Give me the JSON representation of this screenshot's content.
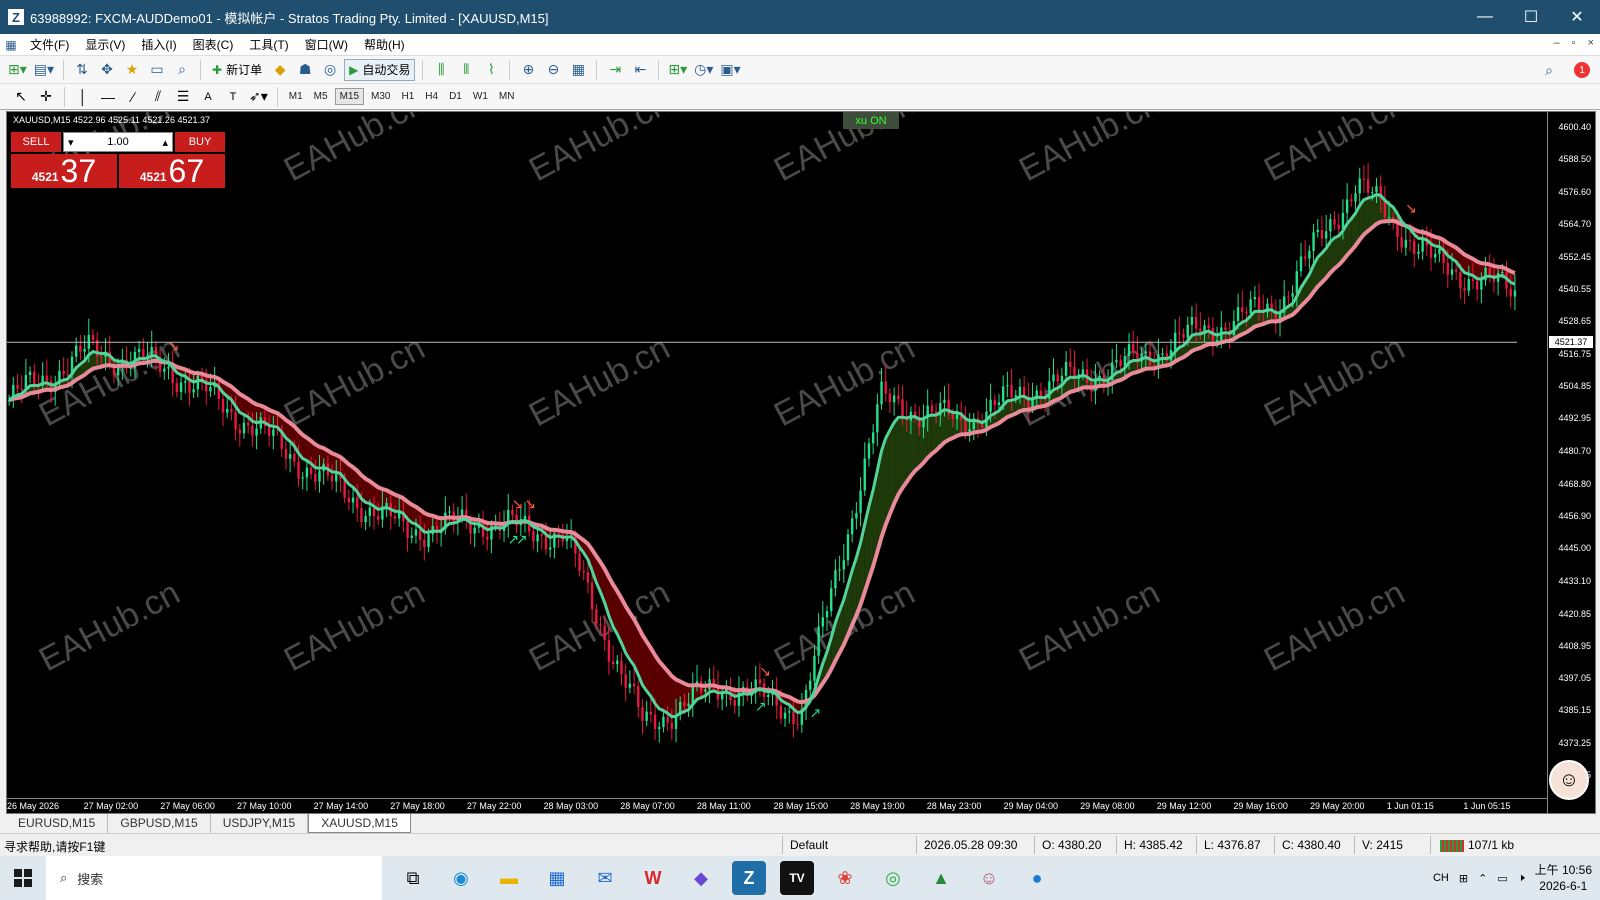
{
  "window": {
    "title": "63988992: FXCM-AUDDemo01 - 模拟帐户 - Stratos Trading Pty. Limited - [XAUUSD,M15]",
    "app_icon": "Z",
    "minimize": "—",
    "maximize": "☐",
    "close": "✕"
  },
  "menu": {
    "items": [
      {
        "label": "文件(F)"
      },
      {
        "label": "显示(V)"
      },
      {
        "label": "插入(I)"
      },
      {
        "label": "图表(C)"
      },
      {
        "label": "工具(T)"
      },
      {
        "label": "窗口(W)"
      },
      {
        "label": "帮助(H)"
      }
    ],
    "mdi_min": "–",
    "mdi_restore": "▫",
    "mdi_close": "×"
  },
  "toolbar": {
    "new_order": "新订单",
    "auto_trading": "自动交易",
    "notify_count": "1"
  },
  "timeframes": [
    {
      "label": "M1"
    },
    {
      "label": "M5"
    },
    {
      "label": "M15"
    },
    {
      "label": "M30"
    },
    {
      "label": "H1"
    },
    {
      "label": "H4"
    },
    {
      "label": "D1"
    },
    {
      "label": "W1"
    },
    {
      "label": "MN"
    }
  ],
  "active_timeframe": "M15",
  "chart": {
    "info": "XAUUSD,M15  4522.96 4525.11 4521.26 4521.37",
    "indicator_label": "xu ON",
    "one_click": {
      "sell": "SELL",
      "buy": "BUY",
      "lot": "1.00",
      "sell_prefix": "4521",
      "sell_big": "37",
      "buy_prefix": "4521",
      "buy_big": "67"
    },
    "current_price": "4521.37",
    "y_labels": [
      "4600.40",
      "4588.50",
      "4576.60",
      "4564.70",
      "4552.45",
      "4540.55",
      "4528.65",
      "4516.75",
      "4504.85",
      "4492.95",
      "4480.70",
      "4468.80",
      "4456.90",
      "4445.00",
      "4433.10",
      "4420.85",
      "4408.95",
      "4397.05",
      "4385.15",
      "4373.25",
      "4361.35"
    ],
    "x_labels": [
      "26 May 2026",
      "27 May 02:00",
      "27 May 06:00",
      "27 May 10:00",
      "27 May 14:00",
      "27 May 18:00",
      "27 May 22:00",
      "28 May 03:00",
      "28 May 07:00",
      "28 May 11:00",
      "28 May 15:00",
      "28 May 19:00",
      "28 May 23:00",
      "29 May 04:00",
      "29 May 08:00",
      "29 May 12:00",
      "29 May 16:00",
      "29 May 20:00",
      "1 Jun 01:15",
      "1 Jun 05:15"
    ],
    "colors": {
      "bull": "#22e08a",
      "bear": "#e8193c",
      "bull_fill": "#1e3a0a",
      "bear_fill": "#5a0000",
      "band": "#e88a9a",
      "band_inner": "#52d39a",
      "bg": "#000000"
    },
    "watermark": "EAHub.cn"
  },
  "chart_data": {
    "type": "candlestick",
    "symbol": "XAUUSD",
    "timeframe": "M15",
    "ylim": [
      4361.35,
      4600.4
    ],
    "x": [
      "26 May 2026",
      "27 May 02:00",
      "27 May 06:00",
      "27 May 10:00",
      "27 May 14:00",
      "27 May 18:00",
      "27 May 22:00",
      "28 May 03:00",
      "28 May 07:00",
      "28 May 11:00",
      "28 May 15:00",
      "28 May 19:00",
      "28 May 23:00",
      "29 May 04:00",
      "29 May 08:00",
      "29 May 12:00",
      "29 May 16:00",
      "29 May 20:00",
      "1 Jun 01:15",
      "1 Jun 05:15"
    ],
    "series": [
      {
        "values": [
          4500,
          4518,
          4512,
          4492,
          4470,
          4452,
          4455,
          4450,
          4380,
          4395,
          4385,
          4500,
          4492,
          4505,
          4512,
          4525,
          4535,
          4580,
          4550,
          4540
        ]
      }
    ]
  },
  "tabs": [
    {
      "label": "EURUSD,M15"
    },
    {
      "label": "GBPUSD,M15"
    },
    {
      "label": "USDJPY,M15"
    },
    {
      "label": "XAUUSD,M15"
    }
  ],
  "status": {
    "help": "寻求帮助,请按F1键",
    "profile": "Default",
    "datetime": "2026.05.28 09:30",
    "open": "O: 4380.20",
    "high": "H: 4385.42",
    "low": "L: 4376.87",
    "close": "C: 4380.40",
    "volume": "V: 2415",
    "traffic": "107/1 kb"
  },
  "taskbar": {
    "search": "搜索",
    "ime": "CH",
    "time": "上午 10:56",
    "date": "2026-6-1"
  }
}
